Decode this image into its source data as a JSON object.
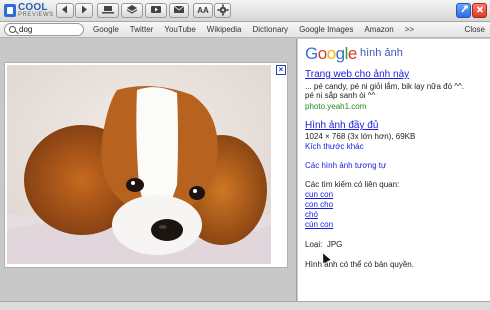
{
  "app": {
    "logo_line1": "COOL",
    "logo_line2": "PREVIEWS"
  },
  "toolbar": {
    "back_icon": "arrow-left-icon",
    "forward_icon": "arrow-right-icon",
    "font_label": "AA"
  },
  "search": {
    "value": "dog",
    "placeholder": ""
  },
  "links": [
    "Google",
    "Twitter",
    "YouTube",
    "Wikipedia",
    "Dictionary",
    "Google Images",
    "Amazon",
    ">>"
  ],
  "close_label": "Close",
  "preview": {
    "close_glyph": "×"
  },
  "panel": {
    "google_word": [
      "G",
      "o",
      "o",
      "g",
      "l",
      "e"
    ],
    "subtitle": "hình ảnh",
    "page_link": "Trang web cho ảnh này",
    "snippet_line1": "... pé candy, pé ni giỏi lắm, bik lạy nữa đó ^^.",
    "snippet_line2": "pé ni sắp sanh òi ^^",
    "site": "photo.yeah1.com",
    "fullsize_link": "Hình ảnh đầy đủ",
    "fullsize_info": "1024 × 768 (3x lớn hơn), 69KB",
    "other_sizes": "Kích thước khác",
    "similar": "Các hình ảnh tương tự",
    "related_title": "Các tìm kiếm có liên quan:",
    "related": [
      "cun con",
      "con cho",
      "chó",
      "cún con"
    ],
    "type_label": "Loại:",
    "type_value": "JPG",
    "copyright": "Hình ảnh có thể có bản quyền."
  }
}
